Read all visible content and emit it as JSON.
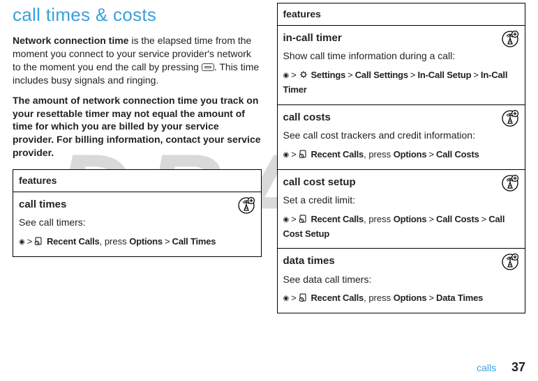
{
  "watermark": "DRAFT",
  "title": "call times & costs",
  "intro_bold_lead": "Network connection time",
  "intro_rest_1": " is the elapsed time from the moment you connect to your service provider's network to the moment you end the call by pressing ",
  "intro_rest_2": ". This time includes busy signals and ringing.",
  "warning": "The amount of network connection time you track on your resettable timer may not equal the amount of time for which you are billed by your service provider. For billing information, contact your service provider.",
  "features_header": "features",
  "left_table": {
    "rows": [
      {
        "name": "call times",
        "desc": "See call timers:",
        "path_parts": [
          "Recent Calls",
          ", press ",
          "Options",
          " > ",
          "Call Times"
        ],
        "path_icon": "recent-calls"
      }
    ]
  },
  "right_table": {
    "rows": [
      {
        "name": "in-call timer",
        "desc": "Show call time information during a call:",
        "path_icon": "settings",
        "path_parts": [
          "Settings",
          " > ",
          "Call Settings",
          " > ",
          "In-Call Setup",
          " > ",
          "In-Call Timer"
        ]
      },
      {
        "name": "call costs",
        "desc": "See call cost trackers and credit information:",
        "path_icon": "recent-calls",
        "path_parts": [
          "Recent Calls",
          ", press ",
          "Options",
          " > ",
          "Call Costs"
        ]
      },
      {
        "name": "call cost setup",
        "desc": "Set a credit limit:",
        "path_icon": "recent-calls",
        "path_parts": [
          "Recent Calls",
          ", press ",
          "Options",
          " > ",
          "Call Costs",
          " > ",
          "Call Cost Setup"
        ]
      },
      {
        "name": "data times",
        "desc": "See data call timers:",
        "path_icon": "recent-calls",
        "path_parts": [
          "Recent Calls",
          ", press ",
          "Options",
          " > ",
          "Data Times"
        ]
      }
    ]
  },
  "footer": {
    "section": "calls",
    "page": "37"
  }
}
